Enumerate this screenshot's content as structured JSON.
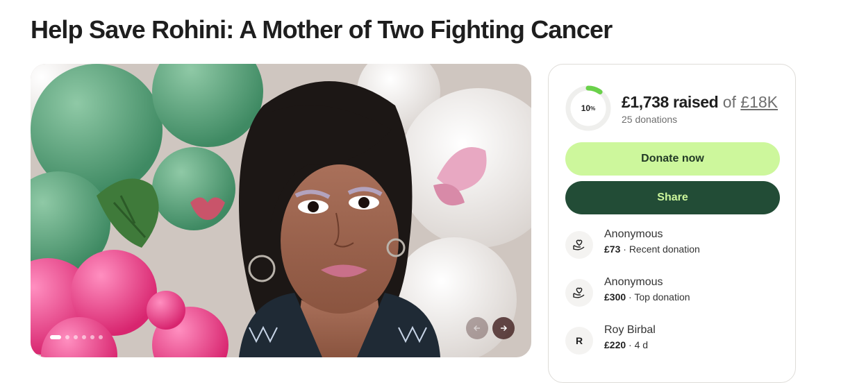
{
  "page": {
    "title": "Help Save Rohini: A Mother of Two Fighting Cancer"
  },
  "carousel": {
    "slide_count": 6,
    "active_index": 0,
    "prev_icon": "arrow-left-icon",
    "next_icon": "arrow-right-icon"
  },
  "progress": {
    "percent_label": "10",
    "percent_sign": "%",
    "fraction": 0.1,
    "ring_color": "#6ad14a",
    "track_color": "#efefed"
  },
  "summary": {
    "raised": "£1,738 raised",
    "of": "of",
    "goal": "£18K",
    "donation_count": "25 donations"
  },
  "actions": {
    "donate_label": "Donate now",
    "share_label": "Share",
    "donate_color": "#cdf79c",
    "share_color": "#224c36"
  },
  "donations": [
    {
      "name": "Anonymous",
      "amount": "£73",
      "detail": "Recent donation",
      "icon": "heart-hand-icon"
    },
    {
      "name": "Anonymous",
      "amount": "£300",
      "detail": "Top donation",
      "icon": "heart-hand-icon"
    },
    {
      "name": "Roy Birbal",
      "amount": "£220",
      "detail": "4 d",
      "initial": "R"
    }
  ]
}
